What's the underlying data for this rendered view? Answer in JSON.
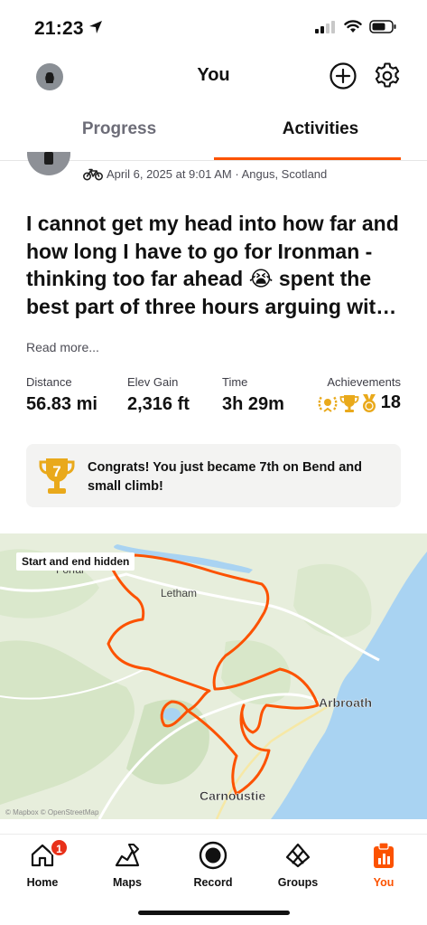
{
  "status_bar": {
    "time": "21:23"
  },
  "nav": {
    "title": "You"
  },
  "tabs": [
    {
      "label": "Progress"
    },
    {
      "label": "Activities"
    }
  ],
  "activity": {
    "meta": "April 6, 2025 at 9:01 AM · Angus, Scotland",
    "title": "I cannot get my head into how far and how long I have to go for Ironman - thinking too far ahead 😭 spent the best part  of three hours arguing wit…",
    "read_more": "Read more...",
    "stats": {
      "distance_label": "Distance",
      "distance_value": "56.83 mi",
      "elev_label": "Elev Gain",
      "elev_value": "2,316 ft",
      "time_label": "Time",
      "time_value": "3h 29m",
      "achievements_label": "Achievements",
      "achievements_count": "18"
    },
    "congrats": {
      "rank": "7",
      "text": "Congrats! You just became 7th on Bend and small climb!"
    }
  },
  "map": {
    "privacy_label": "Start and end hidden",
    "places": {
      "forfar": "Forfar",
      "letham": "Letham",
      "arbroath": "Arbroath",
      "carnoustie": "Carnoustie"
    },
    "route_color": "#fc5200",
    "attribution": "© Mapbox © OpenStreetMap"
  },
  "tabbar": [
    {
      "label": "Home",
      "badge": "1"
    },
    {
      "label": "Maps"
    },
    {
      "label": "Record"
    },
    {
      "label": "Groups"
    },
    {
      "label": "You"
    }
  ],
  "colors": {
    "accent": "#fc5200",
    "badge": "#e8311a",
    "gold": "#e9a91b"
  }
}
